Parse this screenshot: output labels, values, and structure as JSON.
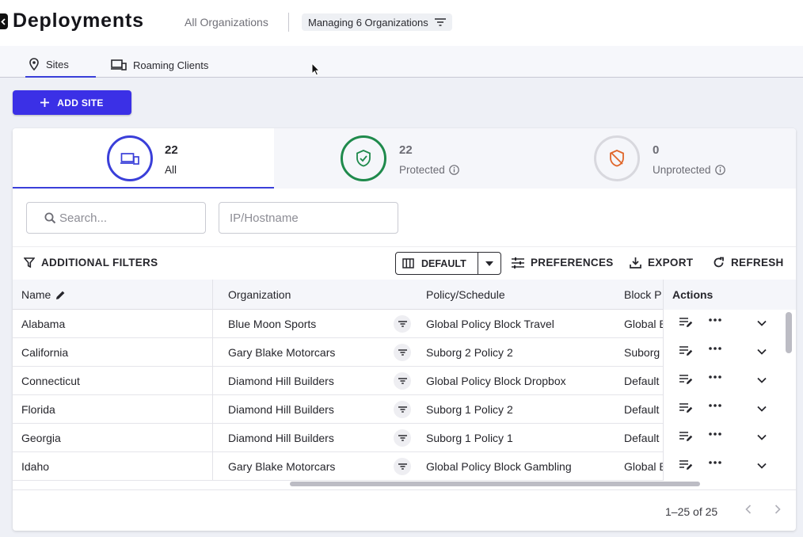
{
  "header": {
    "title": "Deployments",
    "all_orgs": "All Organizations",
    "managing": "Managing 6 Organizations"
  },
  "tabs": [
    {
      "label": "Sites",
      "active": true
    },
    {
      "label": "Roaming Clients",
      "active": false
    }
  ],
  "add_site_label": "ADD SITE",
  "stats": {
    "all": {
      "count": "22",
      "label": "All"
    },
    "protected": {
      "count": "22",
      "label": "Protected"
    },
    "unprotected": {
      "count": "0",
      "label": "Unprotected"
    }
  },
  "filters": {
    "search_placeholder": "Search...",
    "ip_placeholder": "IP/Hostname"
  },
  "toolbar": {
    "additional_filters": "ADDITIONAL FILTERS",
    "view": "DEFAULT",
    "preferences": "PREFERENCES",
    "export": "EXPORT",
    "refresh": "REFRESH"
  },
  "table": {
    "columns": {
      "name": "Name",
      "organization": "Organization",
      "policy": "Policy/Schedule",
      "block": "Block P",
      "actions": "Actions"
    },
    "rows": [
      {
        "name": "Alabama",
        "organization": "Blue Moon Sports",
        "policy": "Global Policy Block Travel",
        "block": "Global Block Page"
      },
      {
        "name": "California",
        "organization": "Gary Blake Motorcars",
        "policy": "Suborg 2 Policy 2",
        "block": "Suborg Block Page"
      },
      {
        "name": "Connecticut",
        "organization": "Diamond Hill Builders",
        "policy": "Global Policy Block Dropbox",
        "block": "Default Block Page"
      },
      {
        "name": "Florida",
        "organization": "Diamond Hill Builders",
        "policy": "Suborg 1 Policy 2",
        "block": "Default Block Page"
      },
      {
        "name": "Georgia",
        "organization": "Diamond Hill Builders",
        "policy": "Suborg 1 Policy 1",
        "block": "Default Block Page"
      },
      {
        "name": "Idaho",
        "organization": "Gary Blake Motorcars",
        "policy": "Global Policy Block Gambling",
        "block": "Global Block Page"
      }
    ]
  },
  "pagination": {
    "range": "1–25 of 25"
  },
  "colors": {
    "accent": "#3b30e6",
    "protected": "#1f8a4c",
    "unprotected": "#e0662a"
  }
}
